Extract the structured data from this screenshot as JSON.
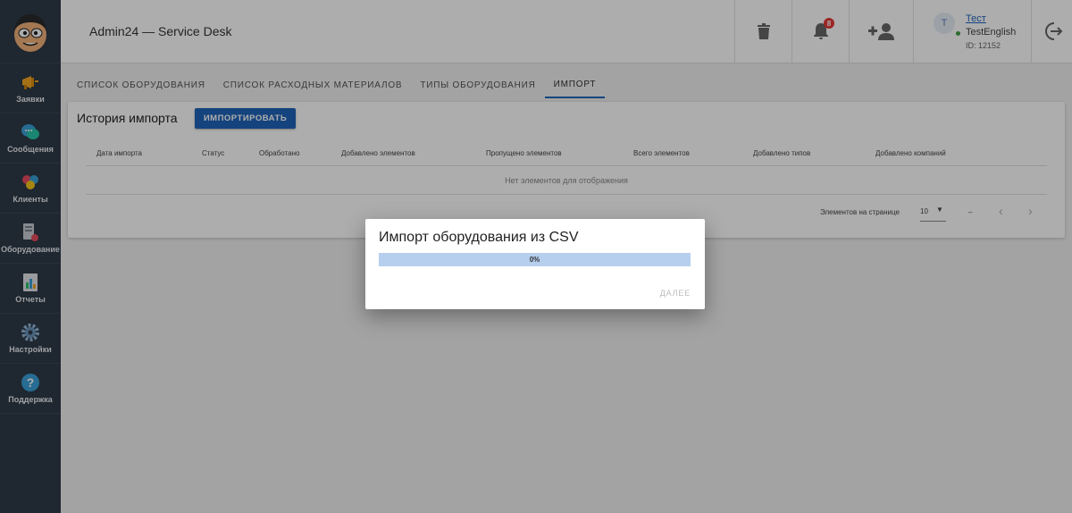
{
  "sidebar": {
    "items": [
      {
        "label": "Заявки"
      },
      {
        "label": "Сообщения"
      },
      {
        "label": "Клиенты"
      },
      {
        "label": "Оборудование"
      },
      {
        "label": "Отчеты"
      },
      {
        "label": "Настройки"
      },
      {
        "label": "Поддержка"
      }
    ]
  },
  "header": {
    "title": "Admin24 — Service Desk",
    "notifications_count": "8",
    "user": {
      "initial": "T",
      "name": "Тест",
      "subtitle": "TestEnglish",
      "id": "ID: 12152"
    }
  },
  "tabs": [
    {
      "label": "СПИСОК ОБОРУДОВАНИЯ"
    },
    {
      "label": "СПИСОК РАСХОДНЫХ МАТЕРИАЛОВ"
    },
    {
      "label": "ТИПЫ ОБОРУДОВАНИЯ"
    },
    {
      "label": "ИМПОРТ",
      "active": true
    }
  ],
  "card": {
    "title": "История импорта",
    "import_button": "ИМПОРТИРОВАТЬ",
    "columns": [
      "Дата импорта",
      "Статус",
      "Обработано",
      "Добавлено элементов",
      "Пропущено элементов",
      "Всего элементов",
      "Добавлено типов",
      "Добавлено компаний"
    ],
    "empty_text": "Нет элементов для отображения",
    "pagination": {
      "per_page_label": "Элементов на странице",
      "per_page_value": "10",
      "range": "–"
    }
  },
  "dialog": {
    "title": "Импорт оборудования из CSV",
    "progress_fraction": 0.0,
    "progress_text": "0%",
    "next_button": "ДАЛЕЕ"
  },
  "colors": {
    "accent": "#1e63b8",
    "sidebar_bg": "#2e3a48",
    "badge": "#e53935",
    "progress_track": "#b6cfee"
  }
}
